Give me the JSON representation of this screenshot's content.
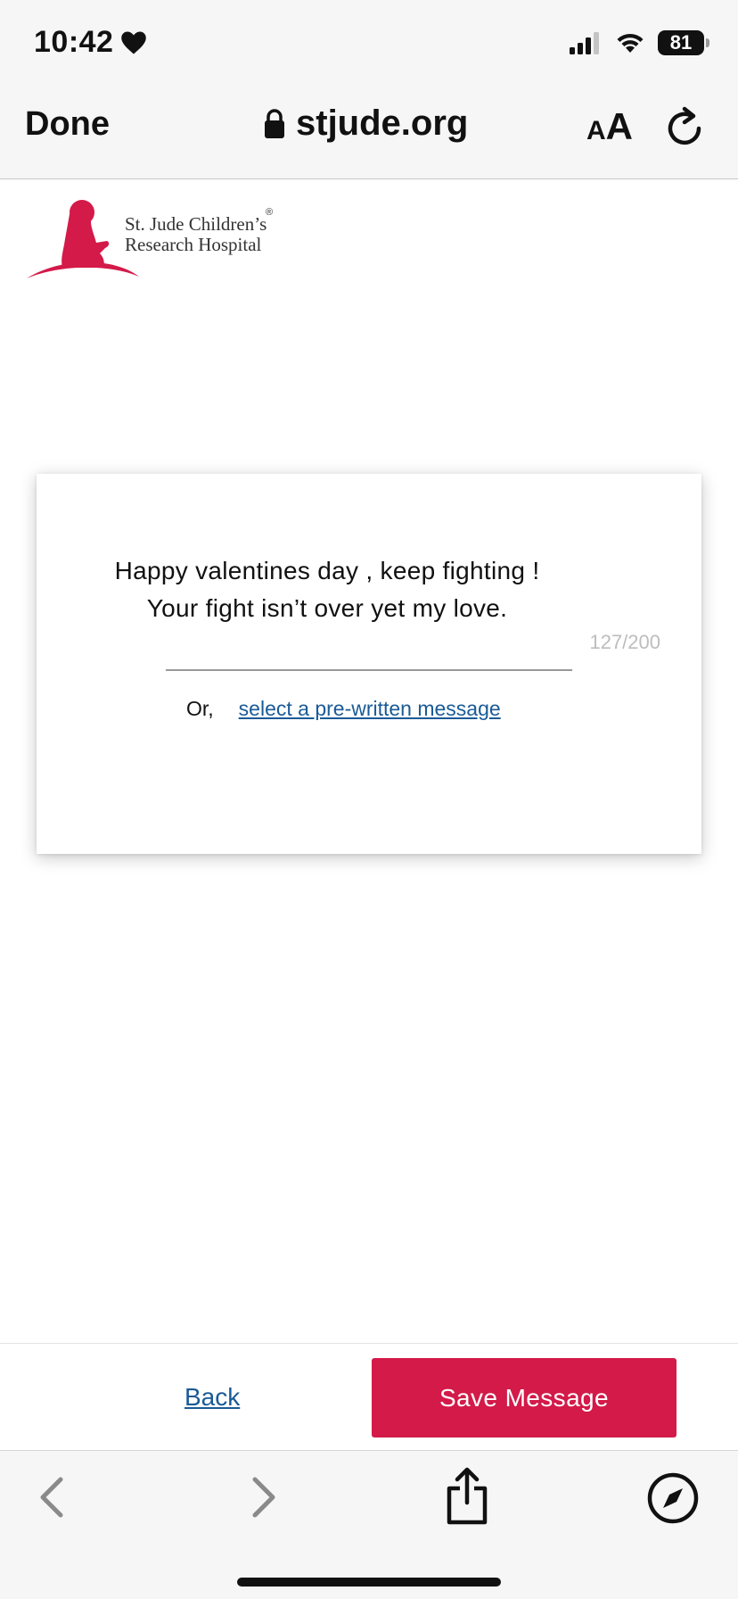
{
  "status_bar": {
    "time": "10:42",
    "battery": "81",
    "icons": [
      "heart-icon",
      "signal-icon",
      "wifi-icon",
      "battery-icon"
    ]
  },
  "browser": {
    "done_label": "Done",
    "url": "stjude.org",
    "text_size_small": "A",
    "text_size_big": "A",
    "icons": [
      "lock-icon",
      "reload-icon",
      "back-arrow-icon",
      "forward-arrow-icon",
      "share-icon",
      "compass-icon"
    ]
  },
  "logo": {
    "line1": "St. Jude Children’s",
    "line2": "Research Hospital",
    "registered": "®",
    "color": "#d31a49"
  },
  "card": {
    "message_line1": "Happy valentines day , keep fighting !",
    "message_line2": "Your fight isn’t over yet my love.",
    "char_count": "127/200",
    "or_label": "Or,",
    "prewritten_link": "select a pre-written message"
  },
  "actions": {
    "back_label": "Back",
    "save_label": "Save Message",
    "save_color": "#d31a49",
    "link_color": "#1a5a96"
  }
}
